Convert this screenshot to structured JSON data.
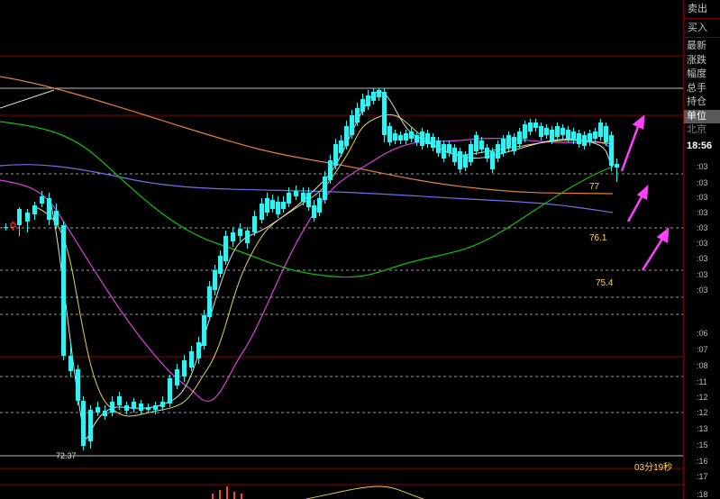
{
  "sidebar": {
    "sell_label": "卖出",
    "buy_label": "买入",
    "menu": [
      {
        "label": "最新",
        "active": false
      },
      {
        "label": "涨跌",
        "active": false
      },
      {
        "label": "幅度",
        "active": false
      },
      {
        "label": "总手",
        "active": false
      },
      {
        "label": "持仓",
        "active": false
      },
      {
        "label": "单位",
        "active": true
      },
      {
        "label": "北京",
        "active": false,
        "dim": true
      }
    ],
    "clock": "18:56",
    "ticks": [
      ":03",
      ":03",
      ":03",
      ":03",
      ":03",
      ":03",
      ":03",
      ":03",
      ":03",
      ":06",
      ":07",
      ":08",
      ":11",
      ":12",
      ":12",
      ":13",
      ":15",
      ":16",
      ":17",
      ":18"
    ]
  },
  "chart": {
    "annotations": {
      "level_a": "77",
      "level_b": "76.1",
      "level_c": "75.4",
      "low": "72.37"
    },
    "countdown": "03分19秒",
    "colors": {
      "bull": "#ff4040",
      "bear": "#36f0f0",
      "ma_fast": "#e0e0e0",
      "ma_yellow": "#e8d060",
      "ma_magenta": "#e040e0",
      "ma_green": "#10c010",
      "ma_blue": "#7070f0",
      "ma_orange": "#e08040",
      "arrow": "#ff40ff",
      "grid_dash": "#9a9a9a",
      "grid_red": "#8a0000"
    }
  }
}
